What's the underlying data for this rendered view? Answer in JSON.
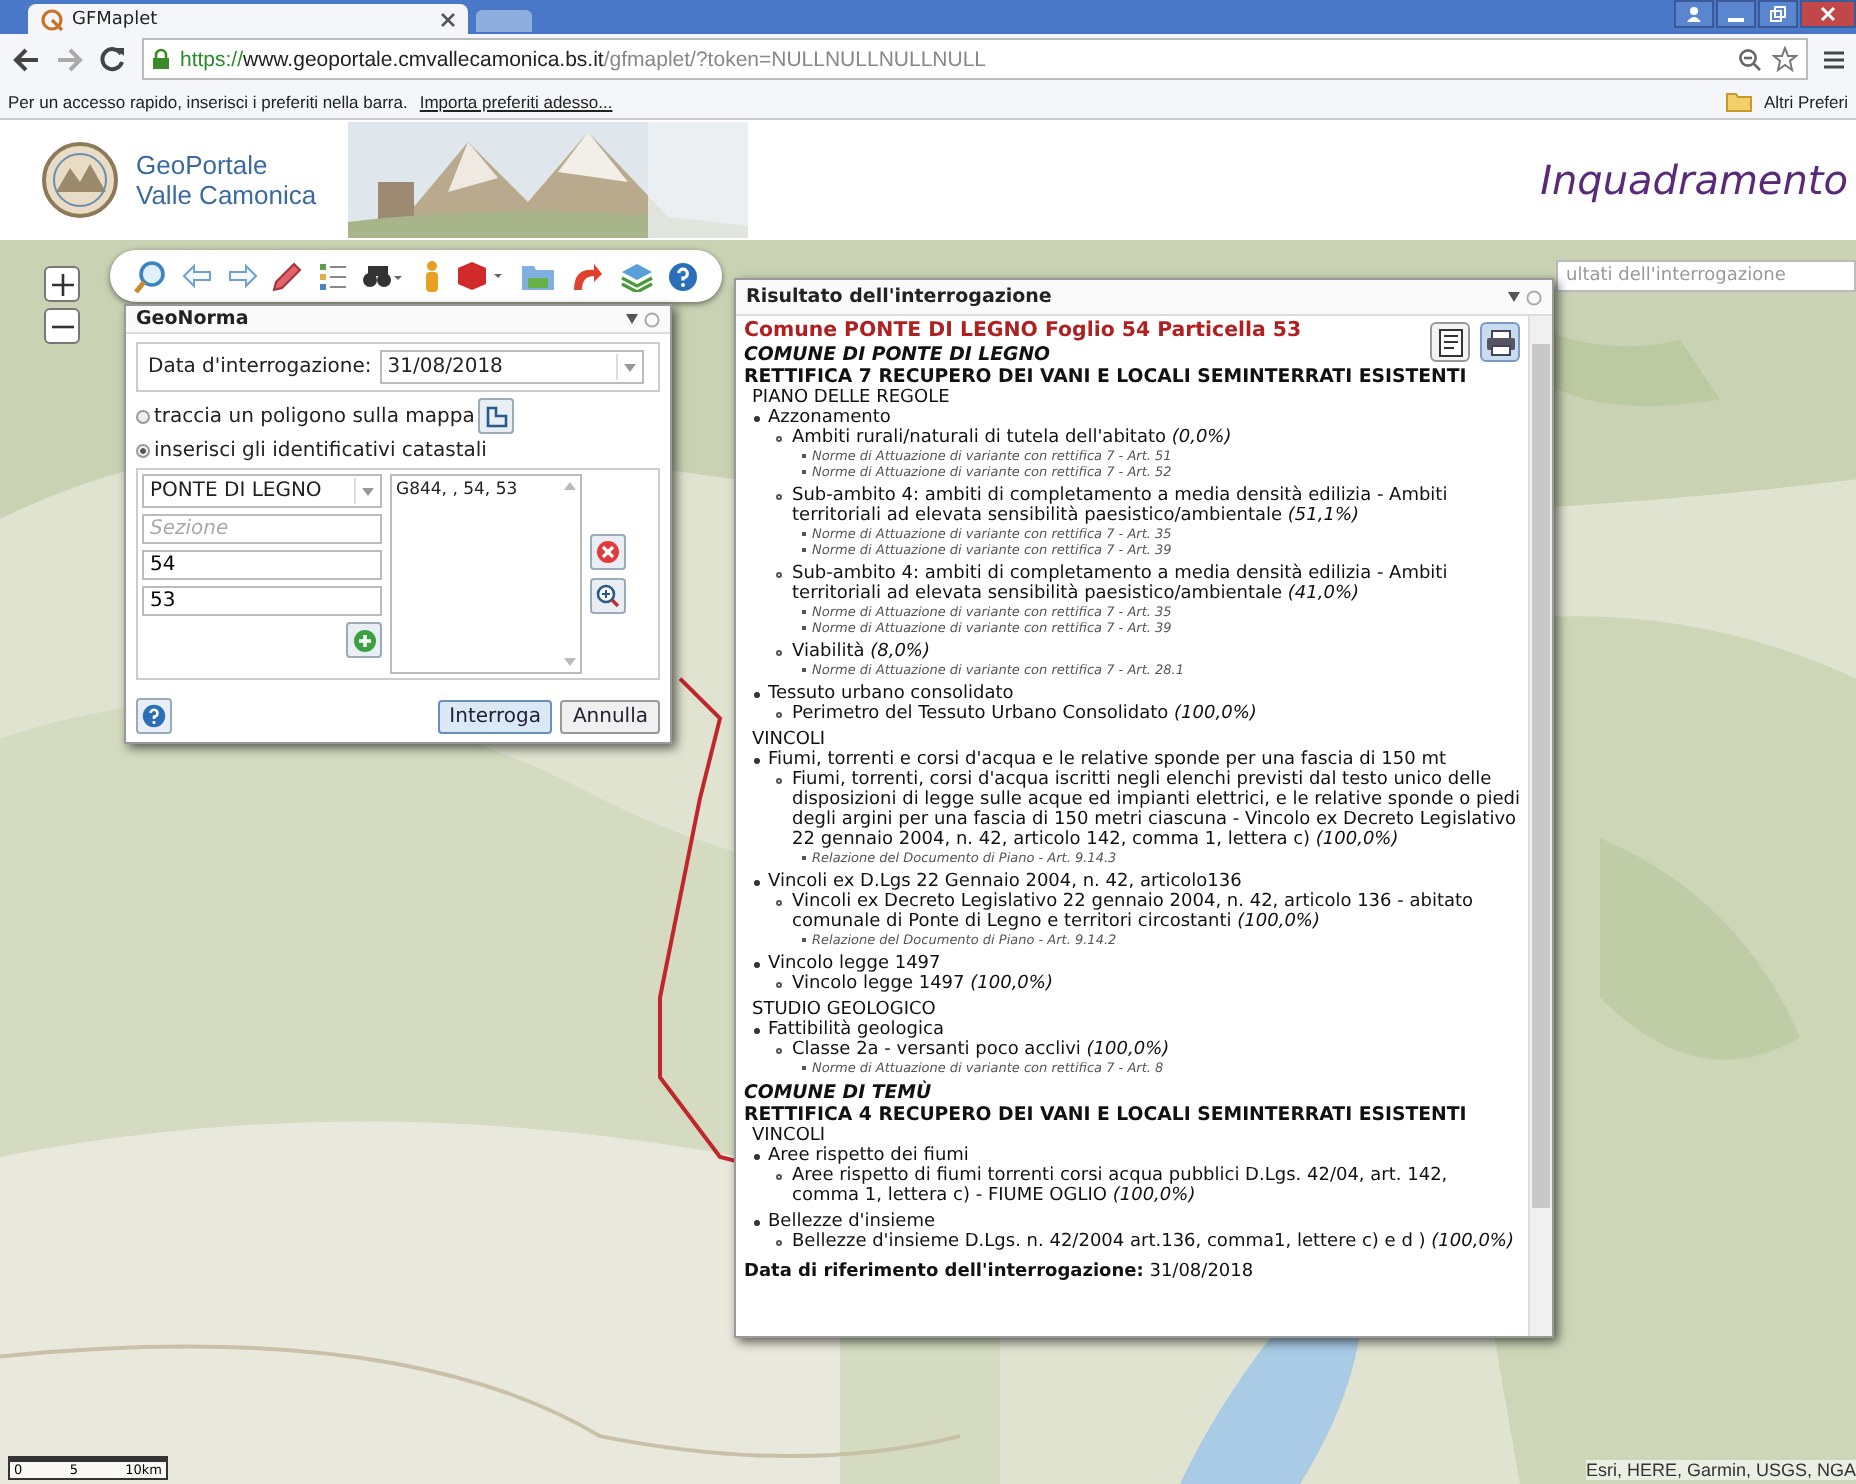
{
  "browser": {
    "tab_title": "GFMaplet",
    "url_scheme": "https://",
    "url_host": "www.geoportale.cmvallecamonica.bs.it",
    "url_path": "/gfmaplet/?token=NULLNULLNULLNULL",
    "bookmarks_hint": "Per un accesso rapido, inserisci i preferiti nella barra.",
    "bookmarks_link": "Importa preferiti adesso...",
    "other_bookmarks": "Altri Preferi"
  },
  "header": {
    "logo_line1": "GeoPortale",
    "logo_line2": "Valle Camonica",
    "title": "Inquadramento"
  },
  "map": {
    "search_placeholder": "ultati dell'interrogazione",
    "attribution": "Esri, HERE, Garmin, USGS, NGA",
    "scale_labels": [
      "0",
      "5",
      "10km"
    ]
  },
  "geonorma": {
    "title": "GeoNorma",
    "date_label": "Data d'interrogazione:",
    "date_value": "31/08/2018",
    "modes": [
      {
        "label": "traccia un poligono sulla mappa",
        "selected": false,
        "kind": "polygon"
      },
      {
        "label": "inserisci gli identificativi catastali",
        "selected": true,
        "kind": "cadastral"
      }
    ],
    "comune": "PONTE DI LEGNO",
    "sezione_placeholder": "Sezione",
    "foglio": "54",
    "particella": "53",
    "list_items": [
      "G844, , 54, 53"
    ],
    "buttons": [
      {
        "label": "Interroga",
        "kind": "primary"
      },
      {
        "label": "Annulla",
        "kind": "plain"
      }
    ]
  },
  "results": {
    "panel_title": "Risultato dell'interrogazione",
    "heading": "Comune PONTE DI LEGNO Foglio 54 Particella 53",
    "comuni": [
      {
        "name": "COMUNE DI PONTE DI LEGNO",
        "rettifica": "RETTIFICA 7 RECUPERO DEI VANI E LOCALI SEMINTERRATI ESISTENTI",
        "sections": [
          {
            "heading": "PIANO DELLE REGOLE",
            "items": [
              {
                "text": "Azzonamento",
                "children": [
                  {
                    "text": "Ambiti rurali/naturali di tutela dell'abitato *(0,0%)*",
                    "notes": [
                      "Norme di Attuazione di variante con rettifica 7 - Art. 51",
                      "Norme di Attuazione di variante con rettifica 7 - Art. 52"
                    ]
                  },
                  {
                    "text": "Sub-ambito 4: ambiti di completamento a media densità edilizia - Ambiti territoriali ad elevata sensibilità paesistico/ambientale *(51,1%)*",
                    "notes": [
                      "Norme di Attuazione di variante con rettifica 7 - Art. 35",
                      "Norme di Attuazione di variante con rettifica 7 - Art. 39"
                    ]
                  },
                  {
                    "text": "Sub-ambito 4: ambiti di completamento a media densità edilizia - Ambiti territoriali ad elevata sensibilità paesistico/ambientale *(41,0%)*",
                    "notes": [
                      "Norme di Attuazione di variante con rettifica 7 - Art. 35",
                      "Norme di Attuazione di variante con rettifica 7 - Art. 39"
                    ]
                  },
                  {
                    "text": "Viabilità *(8,0%)*",
                    "notes": [
                      "Norme di Attuazione di variante con rettifica 7 - Art. 28.1"
                    ]
                  }
                ]
              },
              {
                "text": "Tessuto urbano consolidato",
                "children": [
                  {
                    "text": "Perimetro del Tessuto Urbano Consolidato *(100,0%)*"
                  }
                ]
              }
            ]
          },
          {
            "heading": "VINCOLI",
            "items": [
              {
                "text": "Fiumi, torrenti e corsi d'acqua e le relative sponde per una fascia di 150 mt",
                "children": [
                  {
                    "text": "Fiumi, torrenti, corsi d'acqua iscritti negli elenchi previsti dal testo unico delle disposizioni di legge sulle acque ed impianti elettrici, e le relative sponde o piedi degli argini per una fascia di 150 metri ciascuna - Vincolo ex Decreto Legislativo 22 gennaio 2004, n. 42, articolo 142, comma 1, lettera c) *(100,0%)*",
                    "notes": [
                      "Relazione del Documento di Piano - Art. 9.14.3"
                    ]
                  }
                ]
              },
              {
                "text": "Vincoli ex D.Lgs 22 Gennaio 2004, n. 42, articolo136",
                "children": [
                  {
                    "text": "Vincoli ex Decreto Legislativo 22 gennaio 2004, n. 42, articolo 136 - abitato comunale di Ponte di Legno e territori circostanti *(100,0%)*",
                    "notes": [
                      "Relazione del Documento di Piano - Art. 9.14.2"
                    ]
                  }
                ]
              },
              {
                "text": "Vincolo legge 1497",
                "children": [
                  {
                    "text": "Vincolo legge 1497 *(100,0%)*"
                  }
                ]
              }
            ]
          },
          {
            "heading": "STUDIO GEOLOGICO",
            "items": [
              {
                "text": "Fattibilità geologica",
                "children": [
                  {
                    "text": "Classe 2a - versanti poco acclivi *(100,0%)*",
                    "notes": [
                      "Norme di Attuazione di variante con rettifica 7 - Art. 8"
                    ]
                  }
                ]
              }
            ]
          }
        ]
      },
      {
        "name": "COMUNE DI TEMÙ",
        "rettifica": "RETTIFICA 4 RECUPERO DEI VANI E LOCALI SEMINTERRATI ESISTENTI",
        "sections": [
          {
            "heading": "VINCOLI",
            "items": [
              {
                "text": "Aree rispetto dei fiumi",
                "children": [
                  {
                    "text": "Aree rispetto di fiumi torrenti corsi acqua pubblici D.Lgs. 42/04, art. 142, comma 1, lettera c) - FIUME OGLIO *(100,0%)*"
                  }
                ]
              },
              {
                "text": "Bellezze d'insieme",
                "children": [
                  {
                    "text": "Bellezze d'insieme D.Lgs. n. 42/2004 art.136, comma1, lettere c) e d ) *(100,0%)*"
                  }
                ]
              }
            ]
          }
        ]
      }
    ],
    "footer": "**Data di riferimento dell'interrogazione:** 31/08/2018"
  }
}
